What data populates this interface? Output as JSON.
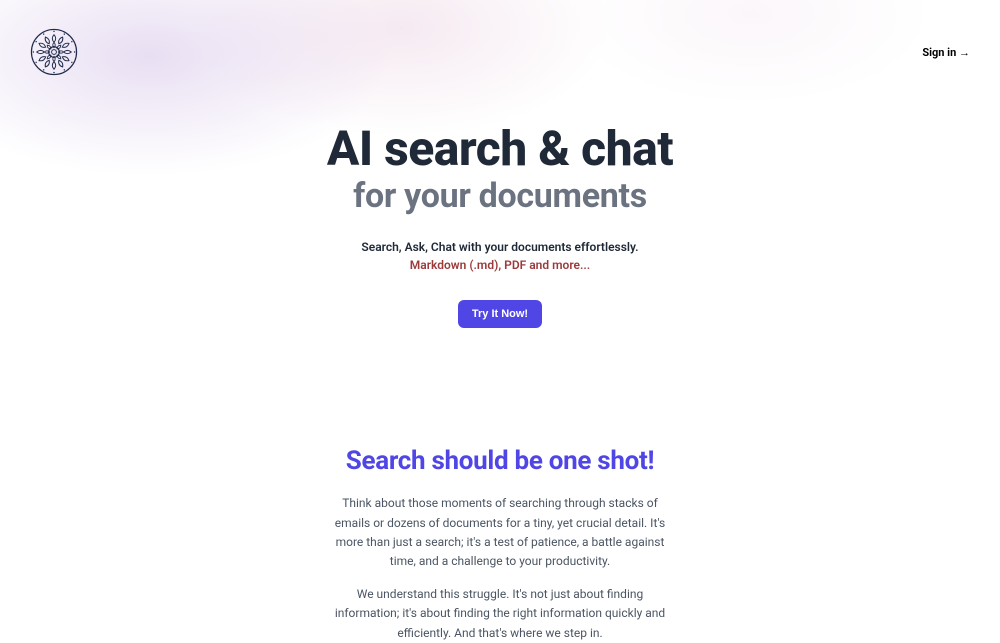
{
  "header": {
    "sign_in_label": "Sign in →"
  },
  "hero": {
    "title": "AI search & chat",
    "subtitle": "for your documents",
    "tagline": "Search, Ask, Chat with your documents effortlessly.",
    "formats": "Markdown (.md), PDF and more...",
    "cta_label": "Try It Now!"
  },
  "section": {
    "title": "Search should be one shot!",
    "para1": "Think about those moments of searching through stacks of emails or dozens of documents for a tiny, yet crucial detail. It's more than just a search; it's a test of patience, a battle against time, and a challenge to your productivity.",
    "para2": "We understand this struggle. It's not just about finding information; it's about finding the right information quickly and efficiently. And that's where we step in."
  },
  "colors": {
    "accent": "#5046e5",
    "text_dark": "#1f2937",
    "text_muted": "#6b7280",
    "formats_color": "#9b3a3a"
  }
}
